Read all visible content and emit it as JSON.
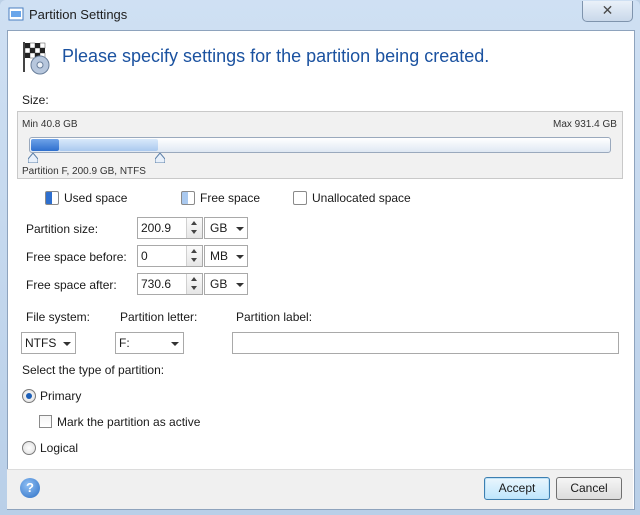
{
  "window": {
    "title": "Partition Settings",
    "close_symbol": "✕"
  },
  "header": {
    "title": "Please specify settings for the partition being created."
  },
  "size": {
    "label": "Size:",
    "min_label": "Min 40.8 GB",
    "max_label": "Max 931.4 GB",
    "partition_caption": "Partition F, 200.9 GB, NTFS"
  },
  "legend": {
    "used": "Used space",
    "free": "Free space",
    "unallocated": "Unallocated space"
  },
  "fields": {
    "partition_size": {
      "label": "Partition size:",
      "value": "200.9",
      "unit": "GB"
    },
    "free_before": {
      "label": "Free space before:",
      "value": "0",
      "unit": "MB"
    },
    "free_after": {
      "label": "Free space after:",
      "value": "730.6",
      "unit": "GB"
    }
  },
  "file_system": {
    "label": "File system:",
    "value": "NTFS"
  },
  "partition_letter": {
    "label": "Partition letter:",
    "value": "F:"
  },
  "partition_label": {
    "label": "Partition label:",
    "value": ""
  },
  "partition_type": {
    "label": "Select the type of partition:",
    "primary": "Primary",
    "mark_active": "Mark the partition as active",
    "logical": "Logical"
  },
  "buttons": {
    "accept": "Accept",
    "cancel": "Cancel",
    "help": "?"
  },
  "colors": {
    "accent": "#1b52a0",
    "used_fill": "#2e6fce",
    "free_fill": "#aac9ef"
  }
}
